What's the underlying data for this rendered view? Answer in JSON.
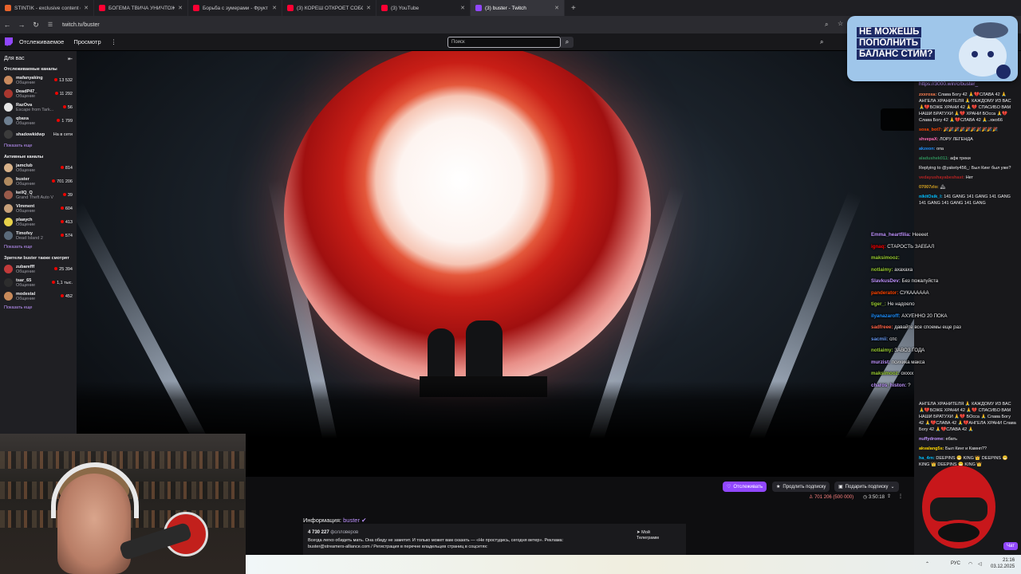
{
  "browser": {
    "tabs": [
      {
        "title": "STINTIK - exclusive content on",
        "color": "#e8632b",
        "active": false
      },
      {
        "title": "БОГЕМА ТВИЧА УНИЧТОЖАЕ",
        "color": "#ff0033",
        "active": false
      },
      {
        "title": "Борьба с зумерами - Фрукт Т",
        "color": "#ff0033",
        "active": false
      },
      {
        "title": "(3) КОРЕШ ОТКРОЕТ СОБСТВ",
        "color": "#ff0033",
        "active": false
      },
      {
        "title": "(3) YouTube",
        "color": "#ff0033",
        "active": false
      },
      {
        "title": "(3) buster - Twitch",
        "color": "#9147ff",
        "active": true
      }
    ],
    "new_tab": "+",
    "url": "twitch.tv/buster"
  },
  "twitch": {
    "nav": {
      "following": "Отслеживаемое",
      "browse": "Просмотр",
      "more": "⋮"
    },
    "search_placeholder": "Поиск",
    "sidebar": {
      "for_you": "Для вас",
      "collapse": "⇤",
      "followed_header": "Отслеживаемые каналы",
      "followed": [
        {
          "name": "mafanyaking",
          "category": "Общение",
          "viewers": "13 532",
          "color": "#c98a5e"
        },
        {
          "name": "DeadP47_",
          "category": "Общение",
          "viewers": "11 292",
          "color": "#a9372f"
        },
        {
          "name": "RazOva",
          "category": "Escape from Tark...",
          "viewers": "56",
          "color": "#e6e6e6"
        },
        {
          "name": "qbaxa",
          "category": "Общение",
          "viewers": "1 799",
          "color": "#6e7f91"
        },
        {
          "name": "shadowkidwp",
          "category": "",
          "viewers": "На в сети",
          "color": "#3b3b3b"
        }
      ],
      "show_more_1": "Показать еще",
      "active_header": "Активные каналы",
      "active": [
        {
          "name": "jamclub",
          "category": "Общение",
          "viewers": "814",
          "color": "#d8b28a"
        },
        {
          "name": "buster",
          "category": "Общение",
          "viewers": "701 206",
          "color": "#b08a60"
        },
        {
          "name": "kellQ_Q",
          "category": "Grand Theft Auto V",
          "viewers": "39",
          "color": "#9a5a4a"
        },
        {
          "name": "Vlmment",
          "category": "Общение",
          "viewers": "604",
          "color": "#c7a07a"
        },
        {
          "name": "plaвусh",
          "category": "Общение",
          "viewers": "413",
          "color": "#e8d24a"
        },
        {
          "name": "Timofey",
          "category": "Dead Island 2",
          "viewers": "574",
          "color": "#5a6a7a"
        }
      ],
      "show_more_2": "Показать еще",
      "viewers_also_header": "Зрители buster также смотрят",
      "also": [
        {
          "name": "zubarefff",
          "category": "Общение",
          "viewers": "25 394",
          "color": "#c23a3a"
        },
        {
          "name": "tsar_65",
          "category": "Общение",
          "viewers": "1,1 тыс.",
          "color": "#2d2d2d"
        },
        {
          "name": "modestal",
          "category": "Общение",
          "viewers": "452",
          "color": "#c88a5a"
        }
      ],
      "show_more_3": "Показать еще"
    },
    "under_video": {
      "follow": "Отслеживать",
      "extend": "Продлить подписку",
      "gift": "Подарить подписку",
      "viewers": "701 206 (500 000)",
      "uptime": "3:50:18",
      "info_label": "Информация:",
      "channel": "buster",
      "followers_count": "4 730 227",
      "followers_label": "фолловеров",
      "description": "Всегда легко обидеть мать. Она обиду не заметит. И только может вам сказать — «Не простудись, сегодня ветер». Реклама: buster@streamers-alliance.com / Регистрация в перечне владельцев страниц в соцсетях:",
      "telegram": "Мой Телеграмм"
    },
    "chat_top": {
      "promo": "https://3000.win/c/buster_"
    },
    "chat": [
      {
        "user": "zxxroxa:",
        "color": "#ff7f50",
        "text": "Слава Богу 42 🙏💔СЛАВА 42 🙏АНГЕЛА ХРАНИТЕЛЯ 🙏 КАЖДОМУ ИЗ ВАС 🙏💔БОЖЕ ХРАНИ 42 🙏💔 СПАСИБО ВАМ НАШИ БРАТУХИ 🙏💔 ХРАНИ БОсса 🙏💔Слава Богу 42 🙏💔СЛАВА 42 🙏..хжо66"
      },
      {
        "user": "sosa_bot7:",
        "color": "#ff4500",
        "text": "🎉🎉🎉🎉🎉🎉🎉🎉🎉🎉"
      },
      {
        "user": "shvepaX:",
        "color": "#ff69b4",
        "text": "ЛОРУ ЛЕГЕНДА"
      },
      {
        "user": "akzeon:",
        "color": "#1e90ff",
        "text": "опа"
      },
      {
        "user": "aladushek011:",
        "color": "#2e8b57",
        "text": "афк треки"
      },
      {
        "user": "",
        "color": "#9b9ba3",
        "text": "Replying to @yakety456_: Был Кинг был уже?"
      },
      {
        "user": "vedayushayabeshast:",
        "color": "#b22222",
        "text": "Нет"
      },
      {
        "user": "07007zlo:",
        "color": "#daa520",
        "text": "🏔"
      },
      {
        "user": "nikitOsik_l:",
        "color": "#00bfff",
        "text": "141 GANG 141 GANG 141 GANG 141 GANG 141 GANG 141 GANG"
      }
    ],
    "overlay_chat": [
      {
        "user": "Emma_heartfilia:",
        "color": "#bf94ff",
        "text": "Heeeet"
      },
      {
        "user": "ignaq:",
        "color": "#ff0000",
        "text": "СТАРОСТЬ ЗАЕБАЛ"
      },
      {
        "user": "maksimooz:",
        "color": "#9acd32",
        "text": ""
      },
      {
        "user": "notlaimy:",
        "color": "#9acd32",
        "text": "ахахаха"
      },
      {
        "user": "SlavkusDev:",
        "color": "#bf94ff",
        "text": "Без пожалуйста"
      },
      {
        "user": "panderator:",
        "color": "#ff4500",
        "text": "СУКАААААА"
      },
      {
        "user": "tiger_:",
        "color": "#9acd32",
        "text": "Не надоело"
      },
      {
        "user": "ilyanazaroff:",
        "color": "#1e90ff",
        "text": "АХУЕННО 20 ПОКА"
      },
      {
        "user": "sadfreee:",
        "color": "#ff6347",
        "text": "давайте все споемы еще раз"
      },
      {
        "user": "sacmii:",
        "color": "#6495ed",
        "text": "спс"
      },
      {
        "user": "notlaimy:",
        "color": "#9acd32",
        "text": "ЗАВОЗ ГОДА"
      },
      {
        "user": "murzist:",
        "color": "#bf94ff",
        "text": "психика макса"
      },
      {
        "user": "maksimooz:",
        "color": "#9acd32",
        "text": "охххх"
      },
      {
        "user": "charos_histon:",
        "color": "#bf94ff",
        "text": "?"
      }
    ],
    "chat_bottom": [
      {
        "user": "",
        "color": "#efeff1",
        "text": "АНГЕЛА ХРАНИТЕЛЯ 🙏 КАЖДОМУ ИЗ ВАС 🙏💔БОЖЕ ХРАНИ 42 🙏💔 СПАСИБО ВАМ НАШИ БРАТУХИ 🙏💔 БОсса 🙏 Слава Богу 42 🙏💔СЛАВА 42 🙏💔АНГЕЛА ХРАНИ Слава Богу 42 🙏💔СЛАВА 42 🙏"
      },
      {
        "user": "nuffydrome:",
        "color": "#bf94ff",
        "text": "ебать"
      },
      {
        "user": "akvalang5s:",
        "color": "#ffd700",
        "text": "Был Кинг и Камнп??"
      },
      {
        "user": "ha_4rn:",
        "color": "#00bfff",
        "text": "DEEPINS 😁 KING 👑 DEEPINS 😁 KING 👑 DEEPINS 😁 KING 👑"
      }
    ],
    "chat_button": "Чат"
  },
  "ad": {
    "lines": [
      "НЕ МОЖЕШЬ",
      "ПОПОЛНИТЬ",
      "БАЛАНС СТИМ?"
    ]
  },
  "taskbar": {
    "lang": "РУС",
    "time": "21:16",
    "date": "03.12.2025"
  }
}
